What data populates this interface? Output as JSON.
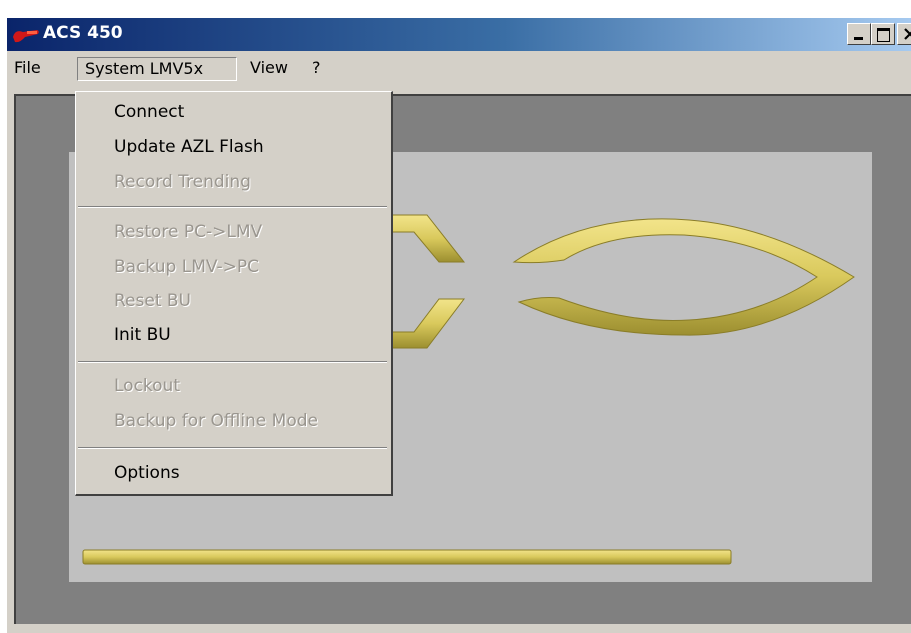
{
  "window": {
    "title": "ACS 450",
    "controls": {
      "minimize": "minimize",
      "maximize": "maximize",
      "close": "close"
    }
  },
  "menubar": {
    "items": [
      {
        "label": "File"
      },
      {
        "label": "System LMV5x"
      },
      {
        "label": "View"
      },
      {
        "label": "?"
      }
    ]
  },
  "dropdown": {
    "items": [
      {
        "label": "Connect",
        "enabled": true
      },
      {
        "label": "Update AZL Flash",
        "enabled": true
      },
      {
        "label": "Record Trending",
        "enabled": false
      },
      {
        "label": "Restore PC->LMV",
        "enabled": false
      },
      {
        "label": "Backup LMV->PC",
        "enabled": false
      },
      {
        "label": "Reset BU",
        "enabled": false
      },
      {
        "label": "Init BU",
        "enabled": true
      },
      {
        "label": "Lockout",
        "enabled": false
      },
      {
        "label": "Backup for Offline Mode",
        "enabled": false
      },
      {
        "label": "Options",
        "enabled": true
      }
    ]
  },
  "colors": {
    "title_gradient_start": "#0a246a",
    "title_gradient_end": "#a6caf0",
    "logo_gold": "#d9c95c",
    "disabled_text": "#9a968f"
  },
  "icons": {
    "app_icon": "red-wrench-icon"
  }
}
